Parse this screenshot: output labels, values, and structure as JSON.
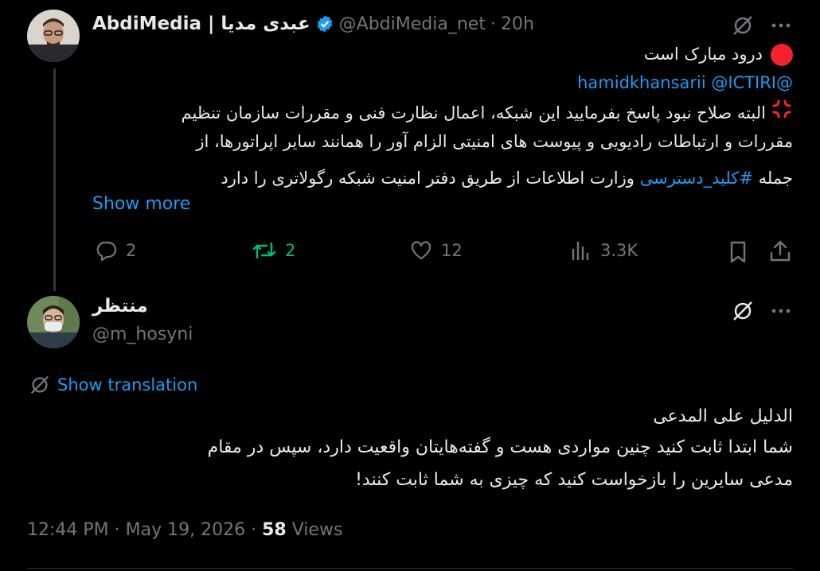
{
  "parent": {
    "author_name": "AbdiMedia | عبدی مدیا",
    "handle": "@AbdiMedia_net",
    "separator": "·",
    "time": "20h",
    "icons": {
      "verified": "verified-badge-icon",
      "grok": "grok-icon",
      "more": "more-icon"
    },
    "line1": "درود مبارک است",
    "mentions": "@hamidkhansarii @ICTIRI",
    "line2": "البته صلاح نبود پاسخ بفرمایید این شبکه، اعمال نظارت فنی و مقررات سازمان تنظیم",
    "line3": "مقررات و ارتباطات رادیویی و پیوست های امنیتی الزام آور را همانند سایر اپراتورها، از",
    "line4_start": "جمله ",
    "hashtag": "#کلید_دسترسی",
    "line4_end": " وزارت اطلاعات از طریق دفتر امنیت شبکه رگولاتری را دارد",
    "show_more": "Show more",
    "actions": {
      "replies": "2",
      "reposts": "2",
      "likes": "12",
      "views": "3.3K"
    }
  },
  "reply": {
    "author_name": "منتظر",
    "handle": "@m_hosyni",
    "show_translation": "Show translation",
    "body_line1": "الدلیل علی المدعی",
    "body_line2": "شما ابتدا ثابت کنید چنین مواردی هست و گفته‌هایتان واقعیت دارد، سپس در مقام",
    "body_line3": "مدعی سایرین را بازخواست کنید که چیزی به شما ثابت کنند!",
    "time": "12:44 PM",
    "dot": "·",
    "date": "May 19, 2026",
    "dot2": "·",
    "views_count": "58",
    "views_label": "Views"
  },
  "colors": {
    "accent": "#1d9bf0",
    "repost_green": "#00ba7c",
    "muted": "#71767b",
    "text": "#e7e9ea",
    "background": "#000000"
  }
}
